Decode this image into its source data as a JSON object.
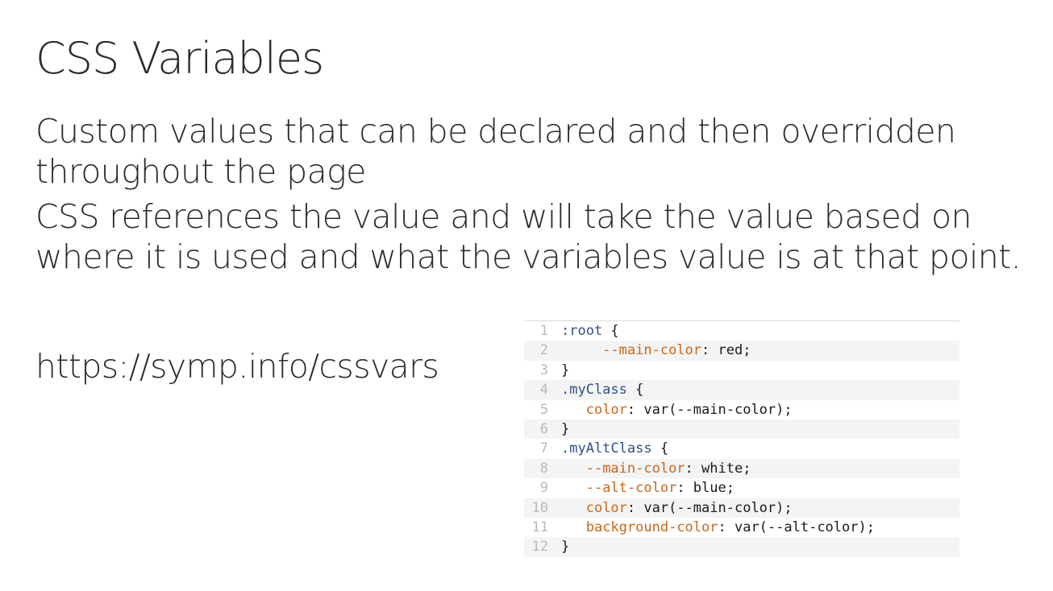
{
  "slide": {
    "title": "CSS Variables",
    "bullets": [
      "Custom values that can be declared and then overridden throughout the page",
      "CSS references the value and will take the value based on where it is used and what the variables value is at that point."
    ],
    "link": "https://symp.info/cssvars"
  },
  "code": {
    "lines": [
      {
        "num": "1",
        "indent": "",
        "sel": ":root",
        "prop": "",
        "sep": "",
        "value": "",
        "tail": " {"
      },
      {
        "num": "2",
        "indent": "     ",
        "sel": "",
        "prop": "--main-color",
        "sep": ": ",
        "value": "red",
        "tail": ";"
      },
      {
        "num": "3",
        "indent": "",
        "sel": "",
        "prop": "",
        "sep": "",
        "value": "",
        "tail": "}"
      },
      {
        "num": "4",
        "indent": "",
        "sel": ".myClass",
        "prop": "",
        "sep": "",
        "value": "",
        "tail": " {"
      },
      {
        "num": "5",
        "indent": "   ",
        "sel": "",
        "prop": "color",
        "sep": ": ",
        "value": "var(--main-color)",
        "tail": ";"
      },
      {
        "num": "6",
        "indent": "",
        "sel": "",
        "prop": "",
        "sep": "",
        "value": "",
        "tail": "}"
      },
      {
        "num": "7",
        "indent": "",
        "sel": ".myAltClass",
        "prop": "",
        "sep": "",
        "value": "",
        "tail": " {"
      },
      {
        "num": "8",
        "indent": "   ",
        "sel": "",
        "prop": "--main-color",
        "sep": ": ",
        "value": "white",
        "tail": ";"
      },
      {
        "num": "9",
        "indent": "   ",
        "sel": "",
        "prop": "--alt-color",
        "sep": ": ",
        "value": "blue",
        "tail": ";"
      },
      {
        "num": "10",
        "indent": "   ",
        "sel": "",
        "prop": "color",
        "sep": ": ",
        "value": "var(--main-color)",
        "tail": ";"
      },
      {
        "num": "11",
        "indent": "   ",
        "sel": "",
        "prop": "background-color",
        "sep": ": ",
        "value": "var(--alt-color)",
        "tail": ";"
      },
      {
        "num": "12",
        "indent": "",
        "sel": "",
        "prop": "",
        "sep": "",
        "value": "",
        "tail": "}"
      }
    ]
  },
  "colors": {
    "selector": "#2e4f87",
    "property": "#c9661b",
    "line_number": "#b9b9b9",
    "stripe": "#f4f4f4"
  }
}
